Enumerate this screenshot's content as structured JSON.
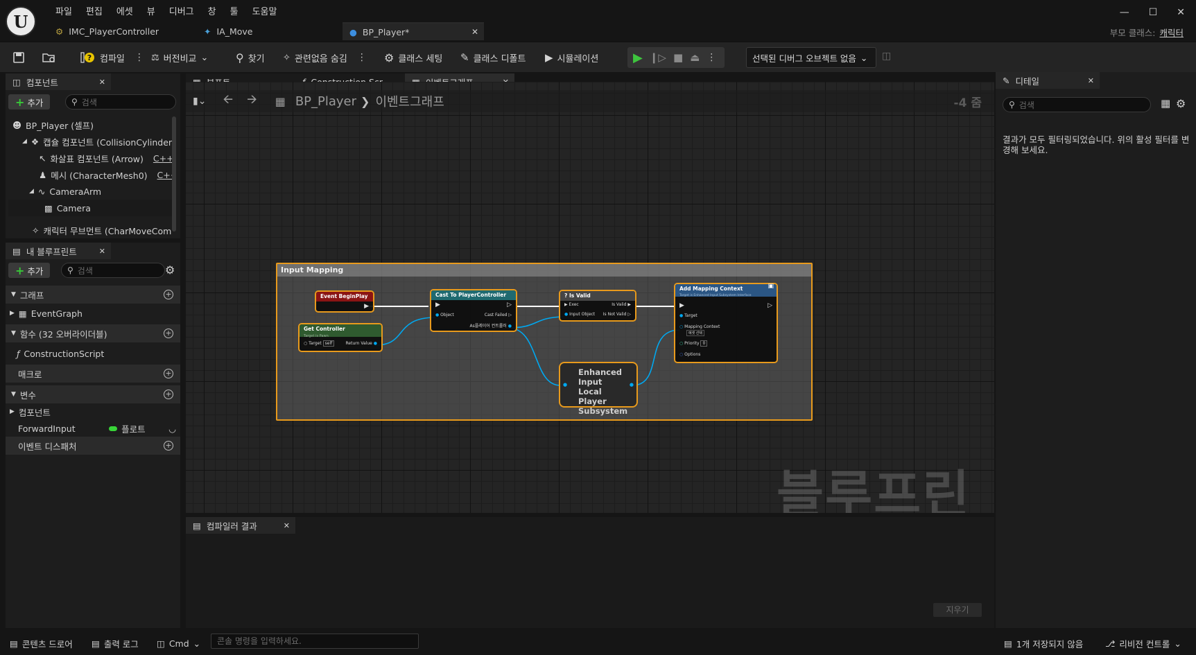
{
  "menu": [
    "파일",
    "편집",
    "에셋",
    "뷰",
    "디버그",
    "창",
    "툴",
    "도움말"
  ],
  "tabs": [
    {
      "label": "IMC_PlayerController"
    },
    {
      "label": "IA_Move"
    },
    {
      "label": "BP_Player*"
    }
  ],
  "parent_class": {
    "label": "부모 클래스:",
    "value": "캐릭터"
  },
  "toolbar": {
    "compile": "컴파일",
    "diff": "버전비교",
    "find": "찾기",
    "hide_unrelated": "관련없음 숨김",
    "class_settings": "클래스 세팅",
    "class_defaults": "클래스 디폴트",
    "simulation": "시뮬레이션",
    "debug_object": "선택된 디버그 오브젝트 없음"
  },
  "components_panel": {
    "title": "컴포넌트",
    "add": "추가",
    "search_placeholder": "검색",
    "items": [
      {
        "label": "BP_Player (셀프)"
      },
      {
        "label": "캡슐 컴포넌트 (CollisionCylinder)"
      },
      {
        "label": "화살표 컴포넌트 (Arrow)",
        "tag": "C++ 0"
      },
      {
        "label": "메시 (CharacterMesh0)",
        "tag": "C++ 0"
      },
      {
        "label": "CameraArm"
      },
      {
        "label": "Camera"
      },
      {
        "label": "캐릭터 무브먼트 (CharMoveCom"
      }
    ]
  },
  "my_blueprint": {
    "title": "내 블루프린트",
    "add": "추가",
    "search_placeholder": "검색",
    "graph_section": "그래프",
    "event_graph": "EventGraph",
    "functions_section": "함수 (32 오버라이더블)",
    "construction_script": "ConstructionScript",
    "macros_section": "매크로",
    "variables_section": "변수",
    "components_group": "컴포넌트",
    "variable_name": "ForwardInput",
    "variable_type": "플로트",
    "dispatchers_section": "이벤트 디스패처"
  },
  "editor_tabs": [
    {
      "label": "뷰포트"
    },
    {
      "label": "Construction Scr..."
    },
    {
      "label": "이벤트그래프"
    }
  ],
  "breadcrumb": {
    "root": "BP_Player",
    "current": "이벤트그래프"
  },
  "zoom": "-4 줌",
  "watermark": "블루프린트",
  "comment": {
    "title": "Input Mapping"
  },
  "nodes": {
    "begin_play": {
      "title": "Event BeginPlay"
    },
    "get_controller": {
      "title": "Get Controller",
      "subtitle": "Target is Pawn",
      "target": "Target",
      "self": "self",
      "return": "Return Value"
    },
    "cast": {
      "title": "Cast To PlayerController",
      "object": "Object",
      "failed": "Cast Failed",
      "as": "As플레이어 컨트롤러"
    },
    "is_valid": {
      "title": "? Is Valid",
      "exec": "Exec",
      "input": "Input Object",
      "valid": "Is Valid",
      "not_valid": "Is Not Valid"
    },
    "subsystem": {
      "title": "Enhanced Input Local Player Subsystem"
    },
    "add_mapping": {
      "title": "Add Mapping Context",
      "subtitle": "Target is Enhanced Input Subsystem Interface",
      "target": "Target",
      "mapping": "Mapping Context",
      "select": "에셋 선택",
      "priority": "Priority",
      "priority_val": "0",
      "options": "Options"
    }
  },
  "compiler": {
    "title": "컴파일러 결과",
    "clear": "지우기"
  },
  "details": {
    "title": "디테일",
    "search_placeholder": "검색",
    "message": "결과가 모두 필터링되었습니다. 위의 활성 필터를 변경해 보세요."
  },
  "statusbar": {
    "content_drawer": "콘텐츠 드로어",
    "output_log": "출력 로그",
    "cmd": "Cmd",
    "console_placeholder": "콘솔 명령을 입력하세요.",
    "unsaved": "1개 저장되지 않음",
    "revision": "리비전 컨트롤"
  }
}
